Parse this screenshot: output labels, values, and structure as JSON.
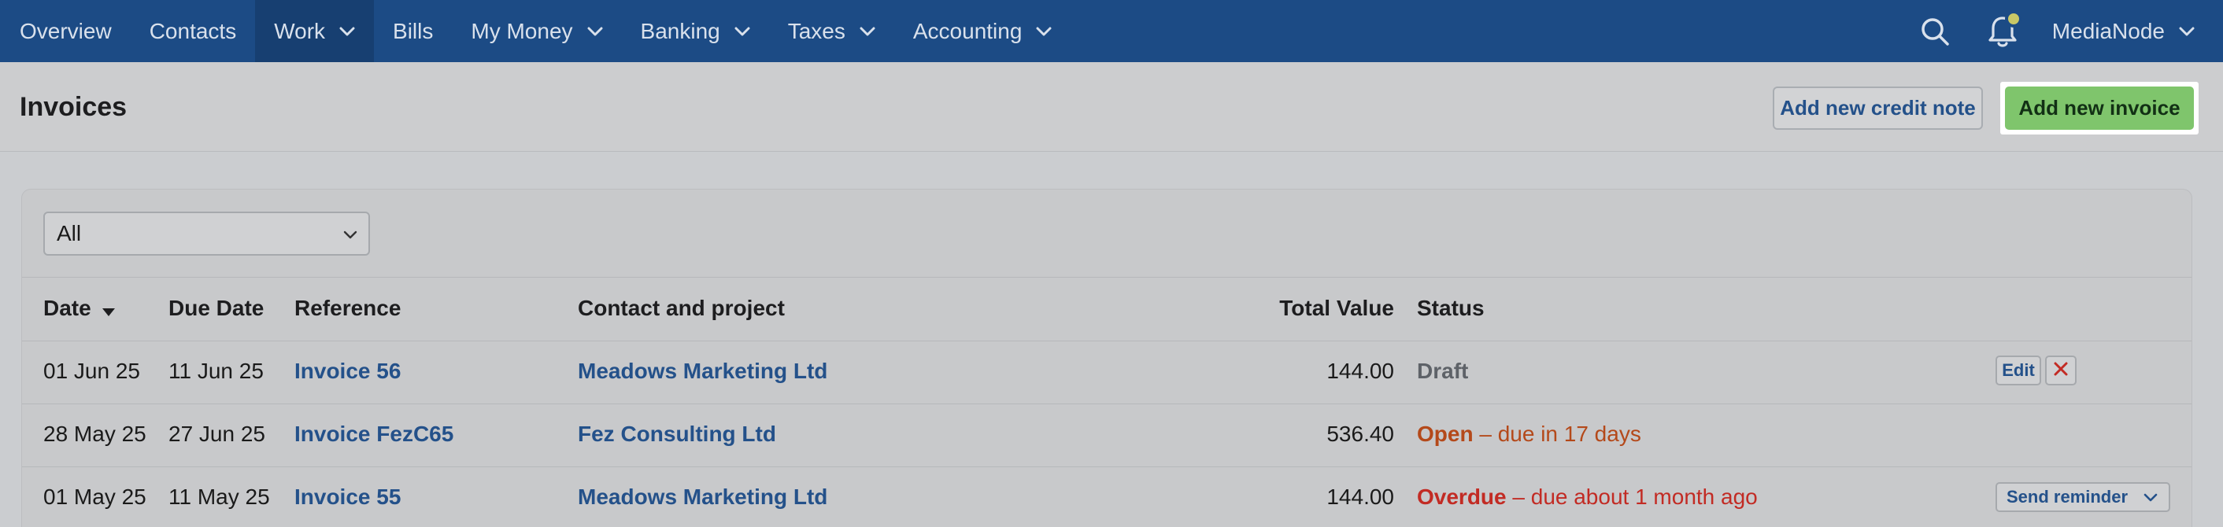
{
  "nav": {
    "items": [
      {
        "label": "Overview",
        "dropdown": false,
        "active": false
      },
      {
        "label": "Contacts",
        "dropdown": false,
        "active": false
      },
      {
        "label": "Work",
        "dropdown": true,
        "active": true
      },
      {
        "label": "Bills",
        "dropdown": false,
        "active": false
      },
      {
        "label": "My Money",
        "dropdown": true,
        "active": false
      },
      {
        "label": "Banking",
        "dropdown": true,
        "active": false
      },
      {
        "label": "Taxes",
        "dropdown": true,
        "active": false
      },
      {
        "label": "Accounting",
        "dropdown": true,
        "active": false
      }
    ],
    "search_icon": "search-icon",
    "notifications_icon": "bell-icon",
    "account_label": "MediaNode"
  },
  "header": {
    "title": "Invoices",
    "credit_note_label": "Add new credit note",
    "new_invoice_label": "Add new invoice"
  },
  "filter": {
    "selected": "All"
  },
  "table": {
    "columns": {
      "date": "Date",
      "due_date": "Due Date",
      "reference": "Reference",
      "contact": "Contact and project",
      "total": "Total Value",
      "status": "Status"
    },
    "rows": [
      {
        "date": "01 Jun 25",
        "due_date": "11 Jun 25",
        "reference": "Invoice 56",
        "contact": "Meadows Marketing Ltd",
        "total": "144.00",
        "status": "Draft",
        "status_detail": "",
        "action": "Edit",
        "delete_icon": "close-icon"
      },
      {
        "date": "28 May 25",
        "due_date": "27 Jun 25",
        "reference": "Invoice FezC65",
        "contact": "Fez Consulting Ltd",
        "total": "536.40",
        "status": "Open",
        "status_detail": " – due in 17 days"
      },
      {
        "date": "01 May 25",
        "due_date": "11 May 25",
        "reference": "Invoice 55",
        "contact": "Meadows Marketing Ltd",
        "total": "144.00",
        "status": "Overdue",
        "status_detail": " – due about 1 month ago",
        "action": "Send reminder"
      }
    ]
  },
  "colors": {
    "nav_bg": "#1c4b85",
    "link": "#24518a",
    "primary_button": "#7fc56c",
    "open_status": "#b4491a",
    "overdue_status": "#c22b24"
  }
}
